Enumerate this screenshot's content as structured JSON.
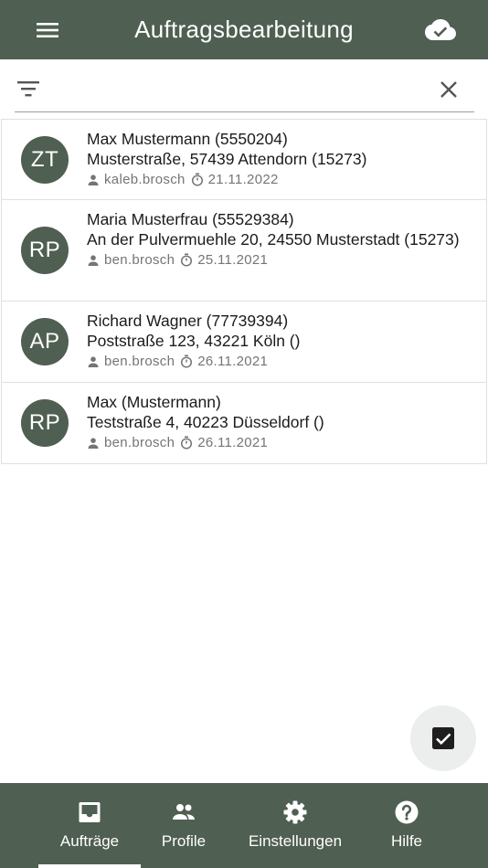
{
  "header": {
    "title": "Auftragsbearbeitung"
  },
  "search": {
    "value": ""
  },
  "orders": [
    {
      "initials": "ZT",
      "name": "Max Mustermann (5550204)",
      "address": "Musterstraße, 57439 Attendorn (15273)",
      "user": "kaleb.brosch",
      "date": "21.11.2022"
    },
    {
      "initials": "RP",
      "name": "Maria Musterfrau (55529384)",
      "address": "An der Pulvermuehle 20, 24550 Musterstadt (15273)",
      "user": "ben.brosch",
      "date": "25.11.2021"
    },
    {
      "initials": "AP",
      "name": "Richard Wagner (77739394)",
      "address": "Poststraße 123, 43221 Köln ()",
      "user": "ben.brosch",
      "date": "26.11.2021"
    },
    {
      "initials": "RP",
      "name": "Max (Mustermann)",
      "address": "Teststraße 4, 40223 Düsseldorf ()",
      "user": "ben.brosch",
      "date": "26.11.2021"
    }
  ],
  "nav": {
    "items": [
      {
        "label": "Aufträge",
        "icon": "inbox-icon"
      },
      {
        "label": "Profile",
        "icon": "people-icon"
      },
      {
        "label": "Einstellungen",
        "icon": "gear-icon"
      },
      {
        "label": "Hilfe",
        "icon": "help-icon"
      }
    ],
    "active": "Aufträge"
  },
  "colors": {
    "primary": "#4f5f51",
    "fab": "#eceded",
    "text": "#1b1b1b",
    "meta": "#757575"
  }
}
